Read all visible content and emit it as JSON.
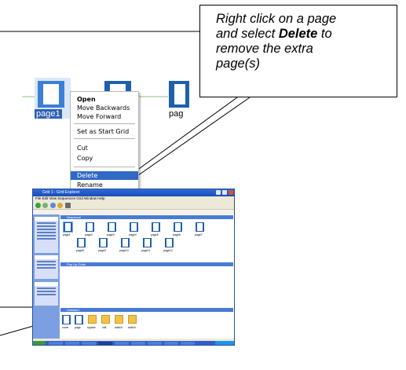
{
  "callout": {
    "line1": "Right click on a page",
    "line2_pre": "and select ",
    "line2_bold": "Delete",
    "line2_post": " to",
    "line3": "remove the extra",
    "line4": "page(s)"
  },
  "thumbnails": {
    "selected_label": "page1",
    "partial_label": "pag"
  },
  "context_menu": {
    "items": [
      "Open",
      "Move Backwards",
      "Move Forward",
      "Set as Start Grid",
      "Cut",
      "Copy",
      "Delete",
      "Rename"
    ],
    "highlighted": "Delete"
  },
  "explorer": {
    "window_title": "Grid 1 - Grid Explorer",
    "menu": "File  Edit  View  Sequences  Grid  Window  Help",
    "groups": {
      "sequence": "Sequence",
      "pop_up": "Pop Up Grids",
      "unlinked": "Unlinked"
    },
    "page_labels_row1": [
      "page1",
      "page2",
      "page3",
      "page4",
      "page5",
      "page6",
      "page7"
    ],
    "page_labels_row2": [
      "page8",
      "page9",
      "page10",
      "page11",
      "page12"
    ],
    "unlinked_labels": [
      "cover",
      "page",
      "square",
      "call",
      "switch",
      "switch"
    ],
    "accent": "#4a7bd4"
  }
}
